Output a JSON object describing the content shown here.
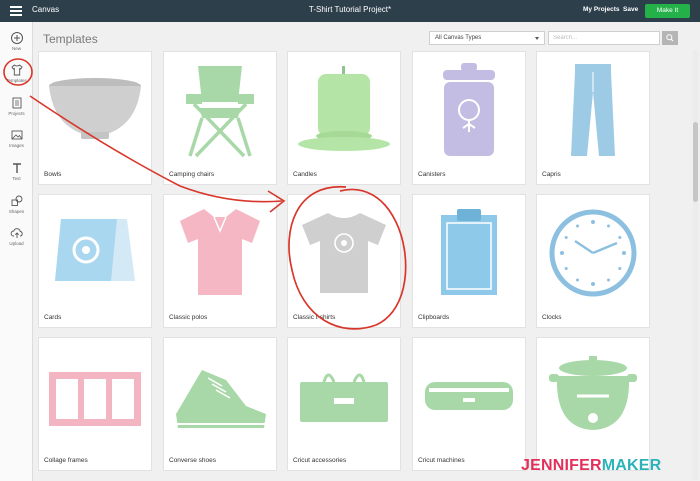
{
  "topbar": {
    "app_name": "Canvas",
    "project_title": "T-Shirt Tutorial Project*",
    "my_projects": "My Projects",
    "save": "Save",
    "make_it": "Make It"
  },
  "sidebar": {
    "items": [
      {
        "label": "New",
        "icon": "plus-circle-icon"
      },
      {
        "label": "Templates",
        "icon": "tshirt-icon"
      },
      {
        "label": "Projects",
        "icon": "projects-icon"
      },
      {
        "label": "Images",
        "icon": "image-icon"
      },
      {
        "label": "Text",
        "icon": "text-icon"
      },
      {
        "label": "Shapes",
        "icon": "shapes-icon"
      },
      {
        "label": "Upload",
        "icon": "upload-cloud-icon"
      }
    ]
  },
  "main": {
    "title": "Templates",
    "type_filter": "All Canvas Types",
    "search_placeholder": "Search..."
  },
  "templates": [
    {
      "label": "Bowls",
      "icon": "bowl",
      "color": "#cfcfcf"
    },
    {
      "label": "Camping chairs",
      "icon": "camping-chair",
      "color": "#a9d8a8"
    },
    {
      "label": "Candles",
      "icon": "candle",
      "color": "#b5e5a6"
    },
    {
      "label": "Canisters",
      "icon": "canister",
      "color": "#c3bde3"
    },
    {
      "label": "Capris",
      "icon": "capris",
      "color": "#9dcbe6"
    },
    {
      "label": "Cards",
      "icon": "card",
      "color": "#a9d7ef"
    },
    {
      "label": "Classic polos",
      "icon": "polo",
      "color": "#f4b7c3"
    },
    {
      "label": "Classic t-shirts",
      "icon": "tshirt",
      "color": "#cfcfcf"
    },
    {
      "label": "Clipboards",
      "icon": "clipboard",
      "color": "#8fc9ea"
    },
    {
      "label": "Clocks",
      "icon": "clock",
      "color": "#8dc0e0"
    },
    {
      "label": "Collage frames",
      "icon": "collage-frame",
      "color": "#f3b5c1"
    },
    {
      "label": "Converse shoes",
      "icon": "shoe",
      "color": "#a9d8a8"
    },
    {
      "label": "Cricut accessories",
      "icon": "cricut-tote",
      "color": "#a9d8a8"
    },
    {
      "label": "Cricut machines",
      "icon": "cricut-machine",
      "color": "#a9d8a8"
    },
    {
      "label": "",
      "icon": "slow-cooker",
      "color": "#a9d8a8"
    }
  ],
  "annotation_color": "#d9362b",
  "watermark": {
    "part1": "JENNIFER",
    "part2": "MAKER"
  }
}
